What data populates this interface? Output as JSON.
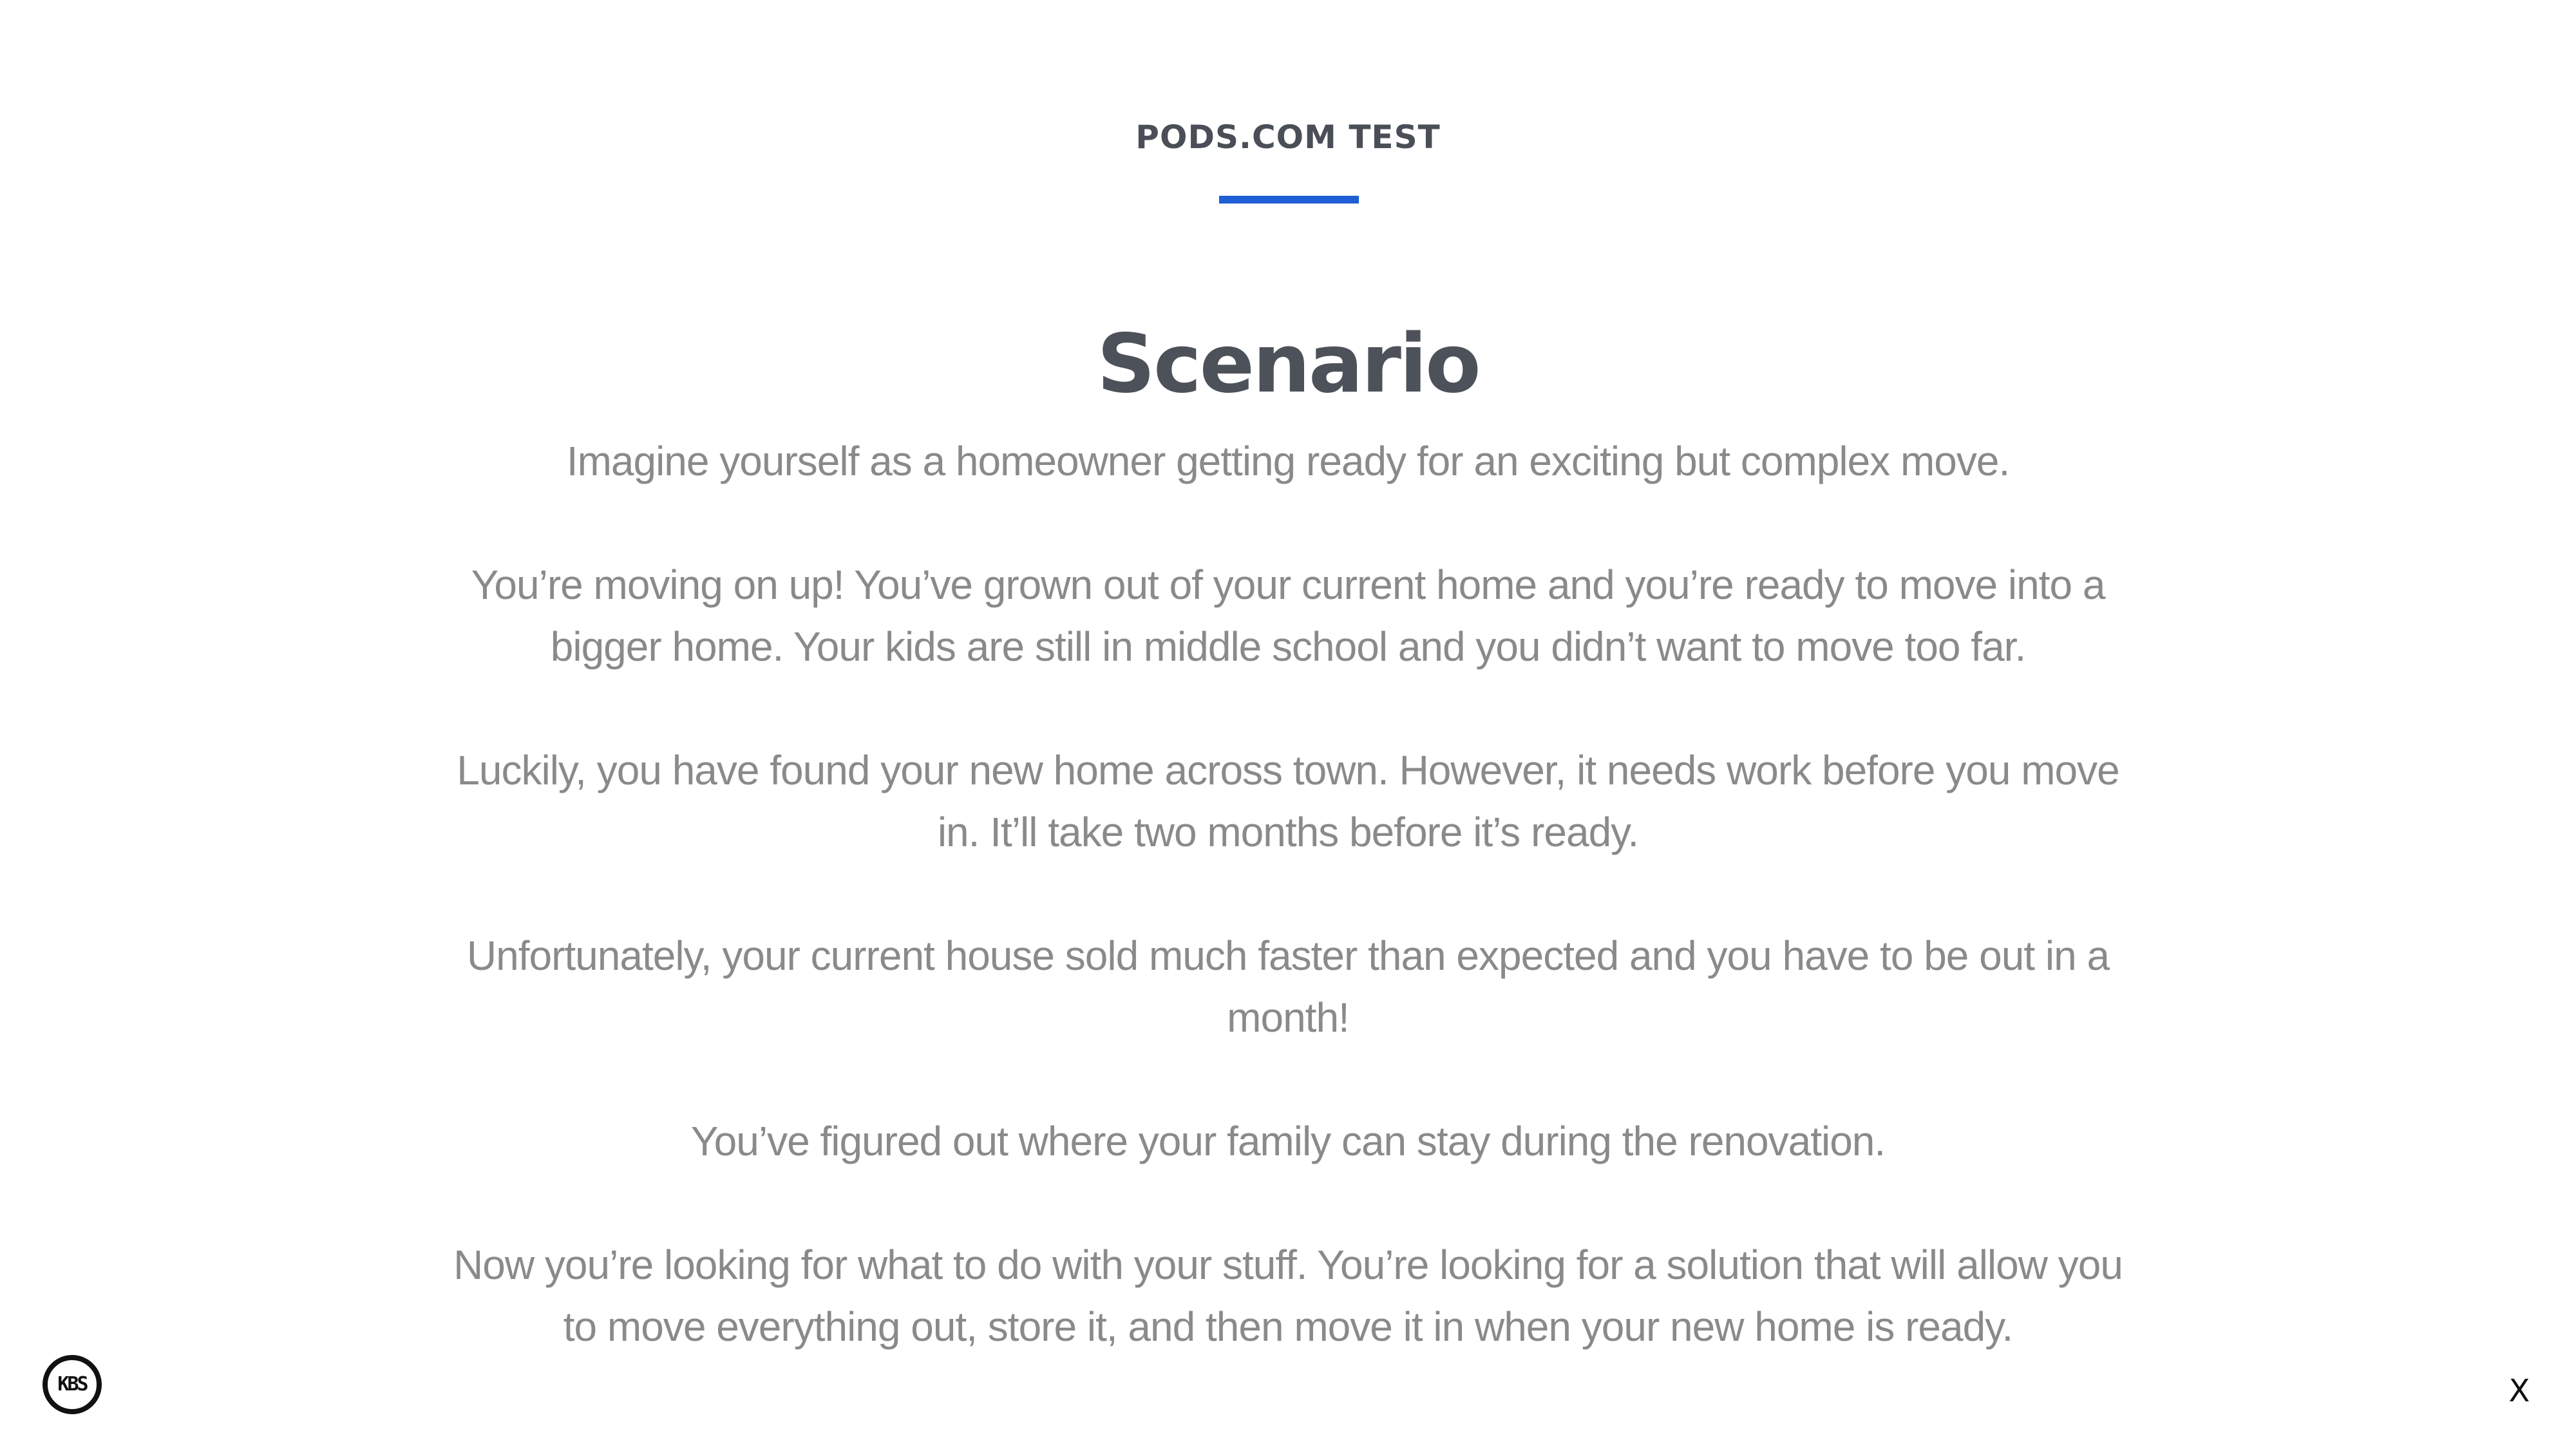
{
  "header": {
    "eyebrow": "PODS.COM TEST",
    "accent_color": "#1f5fd6"
  },
  "main": {
    "title": "Scenario",
    "paragraphs": [
      "Imagine yourself as a homeowner getting ready for an exciting but complex move.",
      "You’re moving on up! You’ve grown out of your current home and you’re ready to move into a bigger home. Your kids are still in middle school and you didn’t want to move too far.",
      "Luckily, you have found your new home across town. However, it needs work before you move in. It’ll take two months before it’s ready.",
      "Unfortunately, your current house sold much faster than expected and you have to be out in a month!",
      "You’ve figured out where your family can stay during the renovation.",
      "Now you’re looking for what to do with your stuff. You’re looking for a solution that will allow you to move everything out, store it, and then move it in when your new home is ready."
    ]
  },
  "footer": {
    "logo_text": "KBS",
    "close_label": "X"
  }
}
